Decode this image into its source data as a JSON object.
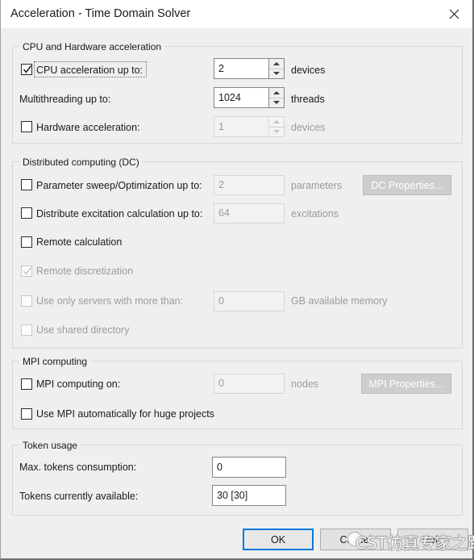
{
  "window": {
    "title": "Acceleration - Time Domain Solver",
    "close_icon": "close-icon"
  },
  "groups": {
    "cpu_hardware": {
      "legend": "CPU and Hardware acceleration",
      "rows": [
        {
          "label": "CPU acceleration up to:",
          "checkbox": true,
          "checked": true,
          "enabled": true,
          "focused": true,
          "value": "2",
          "unit": "devices",
          "spinner": true
        },
        {
          "label": "Multithreading up to:",
          "checkbox": false,
          "enabled": true,
          "value": "1024",
          "unit": "threads",
          "spinner": true
        },
        {
          "label": "Hardware acceleration:",
          "checkbox": true,
          "checked": false,
          "enabled": false,
          "value": "1",
          "unit": "devices",
          "spinner": true
        }
      ]
    },
    "distributed_computing": {
      "legend": "Distributed computing (DC)",
      "properties_button": "DC Properties...",
      "rows": [
        {
          "label": "Parameter sweep/Optimization up to:",
          "checked": false,
          "enabled": true,
          "value": "2",
          "unit": "parameters"
        },
        {
          "label": "Distribute excitation calculation up to:",
          "checked": false,
          "enabled": true,
          "value": "64",
          "unit": "excitations"
        },
        {
          "label": "Remote calculation",
          "checked": false,
          "enabled": true
        },
        {
          "label": "Remote discretization",
          "checked": true,
          "enabled": false
        },
        {
          "label": "Use only servers with more than:",
          "checked": false,
          "enabled": false,
          "value": "0",
          "unit": "GB available memory"
        },
        {
          "label": "Use shared directory",
          "checked": false,
          "enabled": false
        }
      ]
    },
    "mpi_computing": {
      "legend": "MPI computing",
      "properties_button": "MPI Properties...",
      "rows": [
        {
          "label": "MPI computing on:",
          "checked": false,
          "enabled": true,
          "value": "0",
          "unit": "nodes"
        },
        {
          "label": "Use MPI automatically for huge projects",
          "checked": false,
          "enabled": true
        }
      ]
    },
    "token_usage": {
      "legend": "Token usage",
      "rows": [
        {
          "label": "Max. tokens consumption:",
          "value": "0"
        },
        {
          "label": "Tokens currently available:",
          "value": "30 [30]"
        }
      ]
    }
  },
  "footer": {
    "ok": "OK",
    "cancel": "Cancel",
    "help": "Help"
  },
  "overlay": {
    "watermark_text": "CST仿真专家之路"
  },
  "colors": {
    "accent": "#0078d7",
    "dialog_bg": "#efefef",
    "titlebar_bg": "#ffffff",
    "disabled_text": "#9b9b9b",
    "group_border": "#d8d8d8"
  }
}
